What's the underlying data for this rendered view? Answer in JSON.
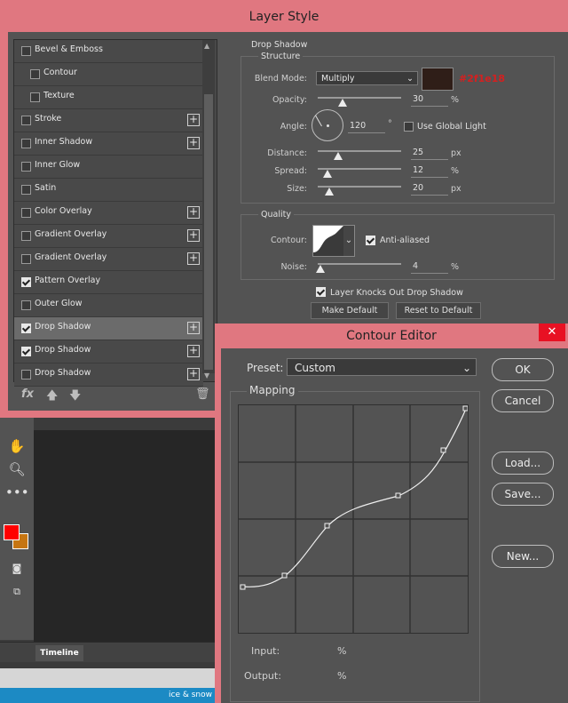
{
  "layer_style": {
    "title": "Layer Style",
    "styles": [
      {
        "label": "Bevel & Emboss",
        "checked": false,
        "plus": false,
        "indent": false,
        "selected": false
      },
      {
        "label": "Contour",
        "checked": false,
        "plus": false,
        "indent": true,
        "selected": false
      },
      {
        "label": "Texture",
        "checked": false,
        "plus": false,
        "indent": true,
        "selected": false
      },
      {
        "label": "Stroke",
        "checked": false,
        "plus": true,
        "indent": false,
        "selected": false
      },
      {
        "label": "Inner Shadow",
        "checked": false,
        "plus": true,
        "indent": false,
        "selected": false
      },
      {
        "label": "Inner Glow",
        "checked": false,
        "plus": false,
        "indent": false,
        "selected": false
      },
      {
        "label": "Satin",
        "checked": false,
        "plus": false,
        "indent": false,
        "selected": false
      },
      {
        "label": "Color Overlay",
        "checked": false,
        "plus": true,
        "indent": false,
        "selected": false
      },
      {
        "label": "Gradient Overlay",
        "checked": false,
        "plus": true,
        "indent": false,
        "selected": false
      },
      {
        "label": "Gradient Overlay",
        "checked": false,
        "plus": true,
        "indent": false,
        "selected": false
      },
      {
        "label": "Pattern Overlay",
        "checked": true,
        "plus": false,
        "indent": false,
        "selected": false
      },
      {
        "label": "Outer Glow",
        "checked": false,
        "plus": false,
        "indent": false,
        "selected": false
      },
      {
        "label": "Drop Shadow",
        "checked": true,
        "plus": true,
        "indent": false,
        "selected": true
      },
      {
        "label": "Drop Shadow",
        "checked": true,
        "plus": true,
        "indent": false,
        "selected": false
      },
      {
        "label": "Drop Shadow",
        "checked": false,
        "plus": true,
        "indent": false,
        "selected": false
      }
    ],
    "fx_label": "fx",
    "drop_shadow": {
      "section_title": "Drop Shadow",
      "structure_title": "Structure",
      "blend_mode_label": "Blend Mode:",
      "blend_mode_value": "Multiply",
      "swatch_color": "#2f1e18",
      "swatch_hex_label": "#2f1e18",
      "opacity_label": "Opacity:",
      "opacity_value": "30",
      "opacity_fraction": 0.3,
      "percent_unit": "%",
      "angle_label": "Angle:",
      "angle_value": "120",
      "degree_unit": "°",
      "use_global_light_label": "Use Global Light",
      "use_global_light": false,
      "distance_label": "Distance:",
      "distance_value": "25",
      "spread_label": "Spread:",
      "spread_value": "12",
      "size_label": "Size:",
      "size_value": "20",
      "px_unit": "px",
      "quality_title": "Quality",
      "contour_label": "Contour:",
      "anti_aliased_label": "Anti-aliased",
      "anti_aliased": true,
      "noise_label": "Noise:",
      "noise_value": "4",
      "knockout_label": "Layer Knocks Out Drop Shadow",
      "knockout": true,
      "make_default_label": "Make Default",
      "reset_default_label": "Reset to Default"
    }
  },
  "contour_editor": {
    "title": "Contour Editor",
    "close_glyph": "✕",
    "preset_label": "Preset:",
    "preset_value": "Custom",
    "mapping_label": "Mapping",
    "ok_label": "OK",
    "cancel_label": "Cancel",
    "load_label": "Load...",
    "save_label": "Save...",
    "new_label": "New...",
    "input_label": "Input:",
    "output_label": "Output:",
    "input_unit": "%",
    "output_unit": "%"
  },
  "background_app": {
    "timeline_tab": "Timeline",
    "status_text": "ice & snow",
    "foreground_color": "#ff0000",
    "background_color": "#c67512"
  }
}
